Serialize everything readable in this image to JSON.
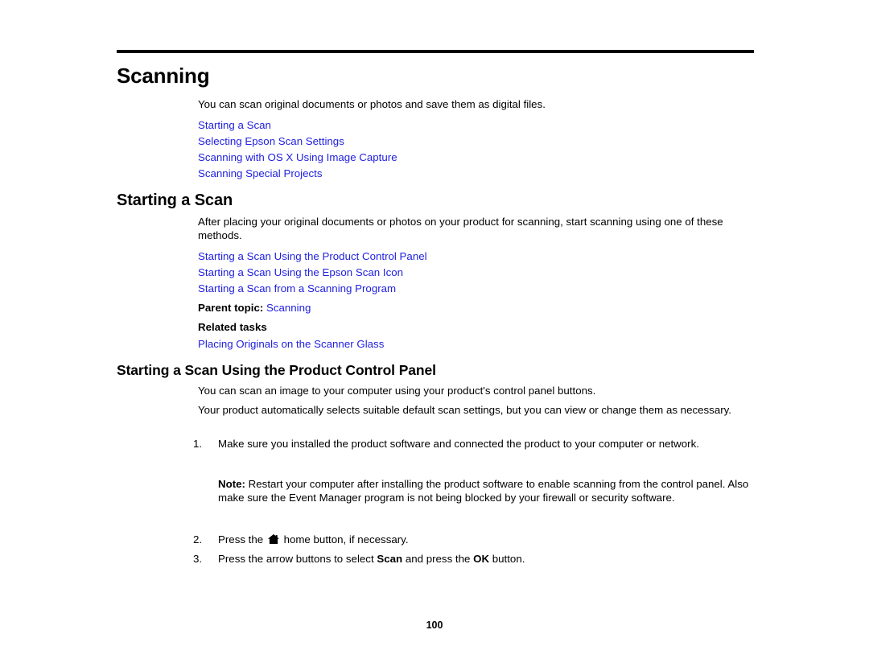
{
  "document": {
    "chapter_title": "Scanning",
    "page_number": "100",
    "link_color": "#2121e0",
    "text_color": "#000000",
    "background_color": "#ffffff"
  },
  "chapter_intro": {
    "paragraph": "You can scan original documents or photos and save them as digital files.",
    "links": [
      "Starting a Scan",
      "Selecting Epson Scan Settings",
      "Scanning with OS X Using Image Capture",
      "Scanning Special Projects"
    ]
  },
  "section_starting_a_scan": {
    "heading": "Starting a Scan",
    "paragraph": "After placing your original documents or photos on your product for scanning, start scanning using one of these methods.",
    "links": [
      "Starting a Scan Using the Product Control Panel",
      "Starting a Scan Using the Epson Scan Icon",
      "Starting a Scan from a Scanning Program"
    ],
    "parent_topic_label": "Parent topic:",
    "parent_topic_link": "Scanning",
    "related_tasks_label": "Related tasks",
    "related_tasks_links": [
      "Placing Originals on the Scanner Glass"
    ]
  },
  "section_control_panel": {
    "heading": "Starting a Scan Using the Product Control Panel",
    "paragraph_1": "You can scan an image to your computer using your product's control panel buttons.",
    "paragraph_2": "Your product automatically selects suitable default scan settings, but you can view or change them as necessary.",
    "steps": [
      {
        "number": "1.",
        "text": "Make sure you installed the product software and connected the product to your computer or network."
      },
      {
        "number": "2.",
        "text_before_icon": "Press the ",
        "icon": "home-icon",
        "text_after_icon": " home button, if necessary."
      },
      {
        "number": "3.",
        "text_part_1": "Press the arrow buttons to select ",
        "bold_1": "Scan",
        "text_part_2": " and press the ",
        "bold_2": "OK",
        "text_part_3": " button."
      }
    ],
    "note": {
      "label": "Note:",
      "text": " Restart your computer after installing the product software to enable scanning from the control panel. Also make sure the Event Manager program is not being blocked by your firewall or security software."
    }
  }
}
